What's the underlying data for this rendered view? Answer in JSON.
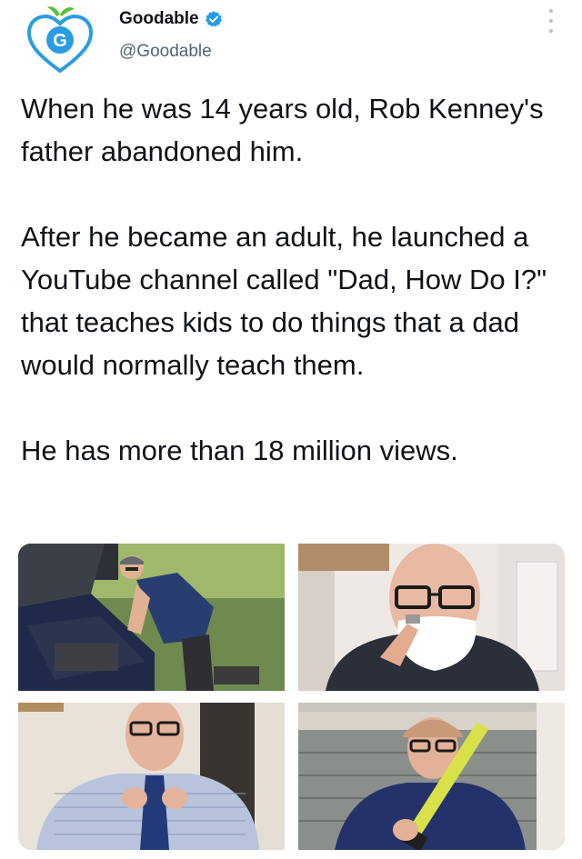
{
  "author": {
    "name": "Goodable",
    "handle": "@Goodable",
    "avatar_letter": "G",
    "verified": true
  },
  "tweet": {
    "paragraphs": [
      "When he was 14 years old, Rob Kenney's father abandoned him.",
      "After he became an adult, he launched a YouTube channel called \"Dad, How Do I?\" that teaches kids to do things that a dad would normally teach them.",
      "He has more than 18 million views."
    ]
  },
  "media": {
    "photos": [
      {
        "subject": "man-working-on-car-engine"
      },
      {
        "subject": "man-shaving-with-foam"
      },
      {
        "subject": "man-tying-necktie"
      },
      {
        "subject": "man-holding-level-tool"
      }
    ]
  },
  "colors": {
    "text": "#0f1419",
    "secondary": "#536471",
    "verified": "#1d9bf0",
    "logo_blue": "#2a9de0",
    "logo_green": "#5cbf3a"
  },
  "icons": [
    "goodable-logo-icon",
    "verified-badge-icon",
    "more-options-icon"
  ]
}
